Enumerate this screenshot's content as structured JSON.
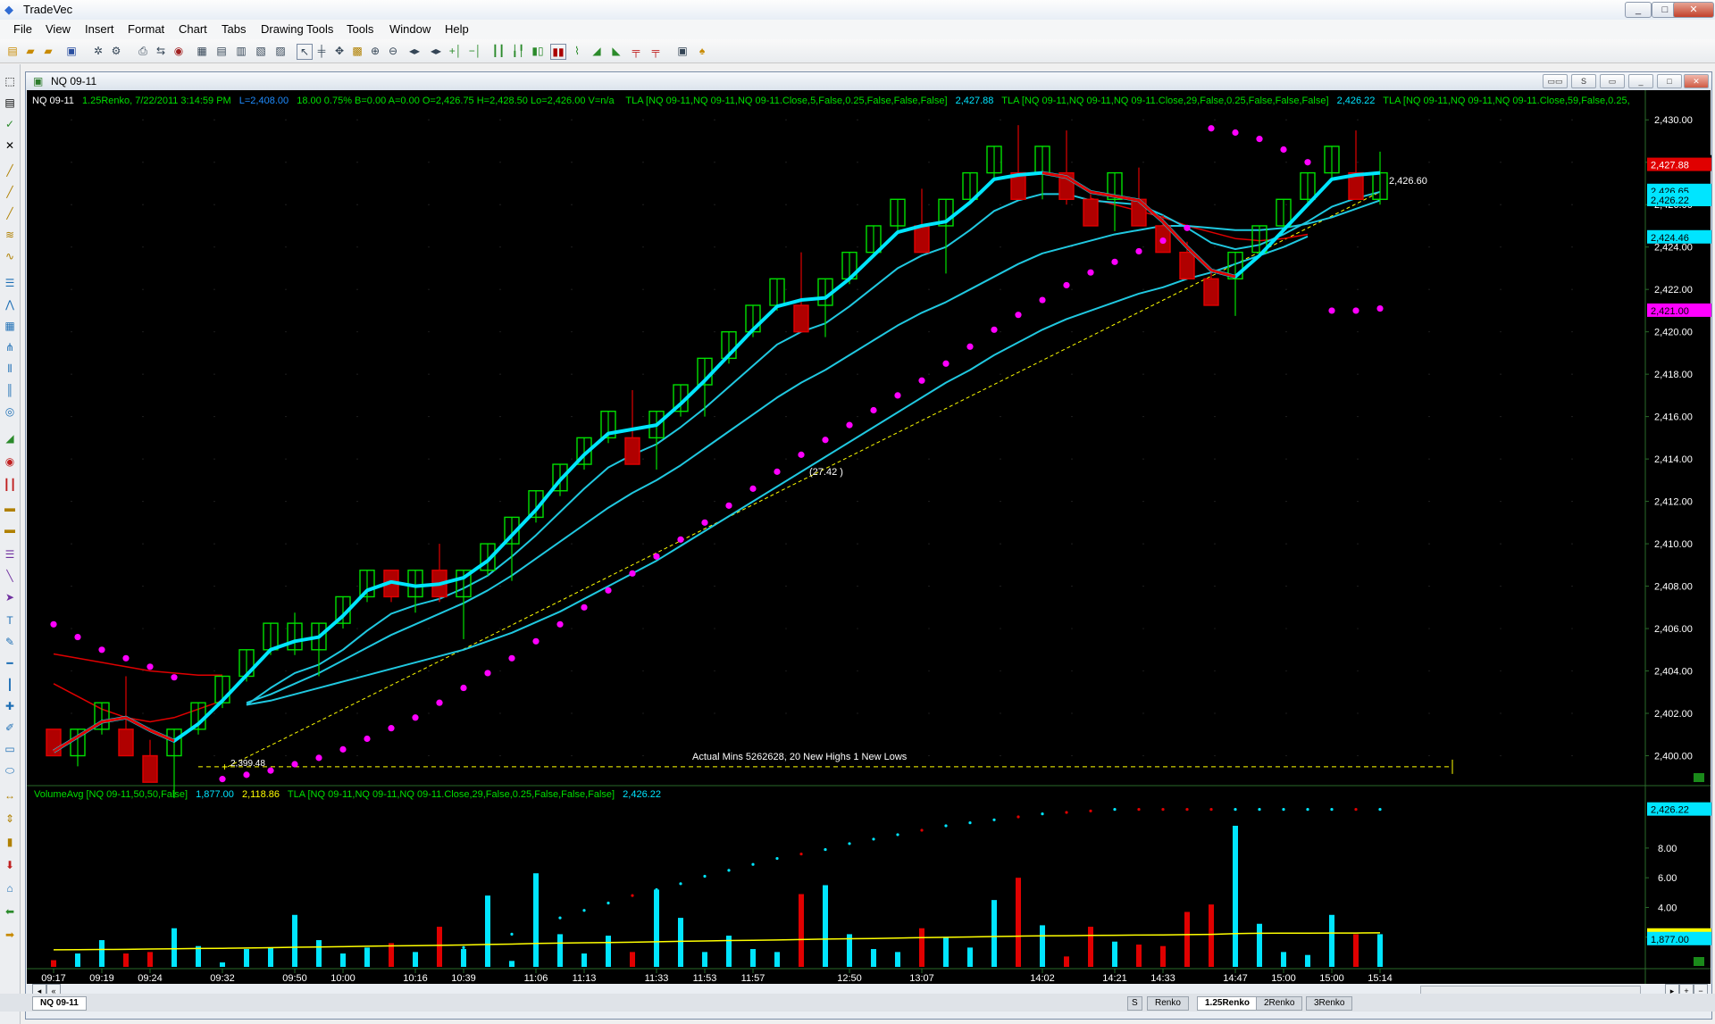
{
  "app": {
    "title": "TradeVec"
  },
  "window_buttons": [
    "_",
    "□",
    "✕"
  ],
  "menu": [
    "File",
    "View",
    "Insert",
    "Format",
    "Chart",
    "Tabs",
    "Drawing Tools",
    "Tools",
    "Window",
    "Help"
  ],
  "chart_window": {
    "title": "NQ 09-11",
    "tab_label": "NQ 09-11"
  },
  "info_line": {
    "symbol": "NQ 09-11",
    "details": "1.25Renko, 7/22/2011 3:14:59 PM",
    "last": "L=2,408.00",
    "stats": "18.00  0.75%  B=0.00  A=0.00  O=2,426.75  H=2,428.50  Lo=2,426.00  V=n/a",
    "tla1_label": "TLA  [NQ 09-11,NQ 09-11,NQ 09-11.Close,5,False,0.25,False,False,False]",
    "tla1_value": "2,427.88",
    "tla2_label": "TLA  [NQ 09-11,NQ 09-11,NQ 09-11.Close,29,False,0.25,False,False,False]",
    "tla2_value": "2,426.22",
    "tla3_label": "TLA  [NQ 09-11,NQ 09-11,NQ 09-11.Close,59,False,0.25,"
  },
  "vol_info_line": {
    "label": "VolumeAvg  [NQ 09-11,50,50,False]",
    "v1": "1,877.00",
    "v2": "2,118.86",
    "tla_label": "TLA  [NQ 09-11,NQ 09-11,NQ 09-11.Close,29,False,0.25,False,False,False]",
    "tla_value": "2,426.22"
  },
  "annotations": {
    "actual_mins": "Actual Mins 5262628, 20 New Highs 1 New Lows",
    "trend_label": "(27.42 )",
    "low_level": "2,399.48",
    "last_level": "2,426.60"
  },
  "price_badges": [
    {
      "text": "2,428.00",
      "value": 2428.0,
      "bg": "#000000",
      "fg": "#ffffff"
    },
    {
      "text": "2,427.88",
      "value": 2427.88,
      "bg": "#e00000",
      "fg": "#ffffff"
    },
    {
      "text": "2,426.65",
      "value": 2426.65,
      "bg": "#00e5ff",
      "fg": "#000000"
    },
    {
      "text": "2,426.22",
      "value": 2426.22,
      "bg": "#00e5ff",
      "fg": "#000000"
    },
    {
      "text": "2,424.46",
      "value": 2424.46,
      "bg": "#00e5ff",
      "fg": "#000000"
    },
    {
      "text": "2,421.00",
      "value": 2421.0,
      "bg": "#ff00ff",
      "fg": "#000000"
    }
  ],
  "vol_badges": [
    {
      "text": "2,426.22",
      "value": 10.6,
      "bg": "#00e5ff",
      "fg": "#000000"
    },
    {
      "text": "2,118.86",
      "value": 2.118,
      "bg": "#ffff00",
      "fg": "#000000"
    },
    {
      "text": "1,877.00",
      "value": 1.877,
      "bg": "#00e5ff",
      "fg": "#000000"
    }
  ],
  "bottom_tabs": [
    "S",
    "Renko",
    "1.25Renko",
    "2Renko",
    "3Renko"
  ],
  "active_tab": "1.25Renko",
  "colors": {
    "up": "#00e000",
    "down": "#e00000",
    "fast_ma": "#00e5ff",
    "slow_ma": "#20c8e0",
    "red_ma": "#e00000",
    "sar": "#ff00ff",
    "vol_avg": "#ffff00",
    "trend": "#ffff00"
  },
  "chart_data": {
    "type": "candlestick",
    "bar_type": "Renko 1.25",
    "price_axis": {
      "min": 2398.8,
      "max": 2430.6,
      "ticks": [
        2400,
        2402,
        2404,
        2406,
        2408,
        2410,
        2412,
        2414,
        2416,
        2418,
        2420,
        2422,
        2424,
        2426,
        2428,
        2430
      ]
    },
    "volume_axis": {
      "min": 0,
      "max": 11,
      "ticks": [
        2,
        4,
        6,
        8
      ]
    },
    "time_labels": [
      "09:17",
      "09:19",
      "09:24",
      "09:32",
      "09:50",
      "10:00",
      "10:16",
      "10:39",
      "11:06",
      "11:13",
      "11:33",
      "11:53",
      "11:57",
      "12:50",
      "13:07",
      "14:02",
      "14:21",
      "14:33",
      "14:47",
      "15:00",
      "15:00",
      "15:14"
    ],
    "time_label_bars": [
      0,
      2,
      4,
      7,
      10,
      12,
      15,
      17,
      20,
      22,
      25,
      27,
      29,
      33,
      36,
      41,
      44,
      46,
      49,
      51,
      53,
      55
    ],
    "candles": [
      {
        "dir": "down",
        "open": 2401.25,
        "close": 2400.0,
        "high": 2401.25,
        "low": 2400.0
      },
      {
        "dir": "up",
        "open": 2400.0,
        "close": 2401.25,
        "high": 2401.25,
        "low": 2399.5
      },
      {
        "dir": "up",
        "open": 2401.25,
        "close": 2402.5,
        "high": 2402.5,
        "low": 2401.0
      },
      {
        "dir": "down",
        "open": 2401.25,
        "close": 2400.0,
        "high": 2403.75,
        "low": 2400.0
      },
      {
        "dir": "down",
        "open": 2400.0,
        "close": 2398.75,
        "high": 2400.75,
        "low": 2398.75
      },
      {
        "dir": "up",
        "open": 2400.0,
        "close": 2401.25,
        "high": 2401.25,
        "low": 2398.0
      },
      {
        "dir": "up",
        "open": 2401.25,
        "close": 2402.5,
        "high": 2402.5,
        "low": 2401.0
      },
      {
        "dir": "up",
        "open": 2402.5,
        "close": 2403.75,
        "high": 2403.75,
        "low": 2402.25
      },
      {
        "dir": "up",
        "open": 2403.75,
        "close": 2405.0,
        "high": 2405.0,
        "low": 2403.5
      },
      {
        "dir": "up",
        "open": 2405.0,
        "close": 2406.25,
        "high": 2406.25,
        "low": 2404.75
      },
      {
        "dir": "up",
        "open": 2405.0,
        "close": 2406.25,
        "high": 2406.75,
        "low": 2404.75
      },
      {
        "dir": "up",
        "open": 2405.0,
        "close": 2406.25,
        "high": 2406.25,
        "low": 2403.75
      },
      {
        "dir": "up",
        "open": 2406.25,
        "close": 2407.5,
        "high": 2407.5,
        "low": 2406.0
      },
      {
        "dir": "up",
        "open": 2407.5,
        "close": 2408.75,
        "high": 2408.75,
        "low": 2407.25
      },
      {
        "dir": "down",
        "open": 2408.75,
        "close": 2407.5,
        "high": 2408.75,
        "low": 2407.25
      },
      {
        "dir": "up",
        "open": 2407.5,
        "close": 2408.75,
        "high": 2408.75,
        "low": 2406.75
      },
      {
        "dir": "down",
        "open": 2408.75,
        "close": 2407.5,
        "high": 2410.0,
        "low": 2407.25
      },
      {
        "dir": "up",
        "open": 2407.5,
        "close": 2408.75,
        "high": 2408.75,
        "low": 2405.5
      },
      {
        "dir": "up",
        "open": 2408.75,
        "close": 2410.0,
        "high": 2410.0,
        "low": 2408.5
      },
      {
        "dir": "up",
        "open": 2410.0,
        "close": 2411.25,
        "high": 2411.25,
        "low": 2408.25
      },
      {
        "dir": "up",
        "open": 2411.25,
        "close": 2412.5,
        "high": 2412.5,
        "low": 2411.0
      },
      {
        "dir": "up",
        "open": 2412.5,
        "close": 2413.75,
        "high": 2413.75,
        "low": 2412.25
      },
      {
        "dir": "up",
        "open": 2413.75,
        "close": 2415.0,
        "high": 2415.0,
        "low": 2413.5
      },
      {
        "dir": "up",
        "open": 2415.0,
        "close": 2416.25,
        "high": 2416.25,
        "low": 2414.75
      },
      {
        "dir": "down",
        "open": 2415.0,
        "close": 2413.75,
        "high": 2417.25,
        "low": 2413.75
      },
      {
        "dir": "up",
        "open": 2415.0,
        "close": 2416.25,
        "high": 2416.25,
        "low": 2413.5
      },
      {
        "dir": "up",
        "open": 2416.25,
        "close": 2417.5,
        "high": 2417.5,
        "low": 2416.0
      },
      {
        "dir": "up",
        "open": 2417.5,
        "close": 2418.75,
        "high": 2418.75,
        "low": 2416.0
      },
      {
        "dir": "up",
        "open": 2418.75,
        "close": 2420.0,
        "high": 2420.0,
        "low": 2418.5
      },
      {
        "dir": "up",
        "open": 2420.0,
        "close": 2421.25,
        "high": 2421.25,
        "low": 2419.75
      },
      {
        "dir": "up",
        "open": 2421.25,
        "close": 2422.5,
        "high": 2422.5,
        "low": 2421.0
      },
      {
        "dir": "down",
        "open": 2421.25,
        "close": 2420.0,
        "high": 2423.75,
        "low": 2420.0
      },
      {
        "dir": "up",
        "open": 2421.25,
        "close": 2422.5,
        "high": 2422.5,
        "low": 2419.75
      },
      {
        "dir": "up",
        "open": 2422.5,
        "close": 2423.75,
        "high": 2423.75,
        "low": 2422.25
      },
      {
        "dir": "up",
        "open": 2423.75,
        "close": 2425.0,
        "high": 2425.0,
        "low": 2423.5
      },
      {
        "dir": "up",
        "open": 2425.0,
        "close": 2426.25,
        "high": 2426.25,
        "low": 2424.75
      },
      {
        "dir": "down",
        "open": 2425.0,
        "close": 2423.75,
        "high": 2426.75,
        "low": 2423.75
      },
      {
        "dir": "up",
        "open": 2425.0,
        "close": 2426.25,
        "high": 2426.25,
        "low": 2422.75
      },
      {
        "dir": "up",
        "open": 2426.25,
        "close": 2427.5,
        "high": 2427.5,
        "low": 2426.0
      },
      {
        "dir": "up",
        "open": 2427.5,
        "close": 2428.75,
        "high": 2428.75,
        "low": 2427.25
      },
      {
        "dir": "down",
        "open": 2427.5,
        "close": 2426.25,
        "high": 2429.75,
        "low": 2426.25
      },
      {
        "dir": "up",
        "open": 2427.5,
        "close": 2428.75,
        "high": 2428.75,
        "low": 2426.25
      },
      {
        "dir": "down",
        "open": 2427.5,
        "close": 2426.25,
        "high": 2429.5,
        "low": 2426.0
      },
      {
        "dir": "down",
        "open": 2426.25,
        "close": 2425.0,
        "high": 2426.5,
        "low": 2425.0
      },
      {
        "dir": "up",
        "open": 2426.25,
        "close": 2427.5,
        "high": 2427.5,
        "low": 2424.75
      },
      {
        "dir": "down",
        "open": 2426.25,
        "close": 2425.0,
        "high": 2427.75,
        "low": 2425.0
      },
      {
        "dir": "down",
        "open": 2425.0,
        "close": 2423.75,
        "high": 2425.5,
        "low": 2423.75
      },
      {
        "dir": "down",
        "open": 2423.75,
        "close": 2422.5,
        "high": 2424.25,
        "low": 2422.5
      },
      {
        "dir": "down",
        "open": 2422.5,
        "close": 2421.25,
        "high": 2423.0,
        "low": 2421.25
      },
      {
        "dir": "up",
        "open": 2422.5,
        "close": 2423.75,
        "high": 2423.75,
        "low": 2420.75
      },
      {
        "dir": "up",
        "open": 2423.75,
        "close": 2425.0,
        "high": 2425.0,
        "low": 2423.5
      },
      {
        "dir": "up",
        "open": 2425.0,
        "close": 2426.25,
        "high": 2426.25,
        "low": 2424.75
      },
      {
        "dir": "up",
        "open": 2426.25,
        "close": 2427.5,
        "high": 2427.5,
        "low": 2426.0
      },
      {
        "dir": "up",
        "open": 2427.5,
        "close": 2428.75,
        "high": 2428.75,
        "low": 2427.25
      },
      {
        "dir": "down",
        "open": 2427.5,
        "close": 2426.25,
        "high": 2429.5,
        "low": 2426.25
      },
      {
        "dir": "up",
        "open": 2426.25,
        "close": 2427.5,
        "high": 2428.5,
        "low": 2426.0
      }
    ],
    "ma_fast": [
      2400.2,
      2400.9,
      2401.6,
      2401.8,
      2401.2,
      2400.7,
      2401.5,
      2402.6,
      2403.8,
      2405.0,
      2405.4,
      2405.6,
      2406.6,
      2407.8,
      2408.2,
      2408.0,
      2408.1,
      2408.4,
      2409.2,
      2410.4,
      2411.6,
      2413.0,
      2414.2,
      2415.2,
      2415.4,
      2415.6,
      2416.6,
      2417.7,
      2418.9,
      2420.1,
      2421.2,
      2421.5,
      2421.6,
      2422.5,
      2423.6,
      2424.7,
      2425.0,
      2425.2,
      2426.1,
      2427.2,
      2427.4,
      2427.5,
      2427.3,
      2426.6,
      2426.4,
      2426.2,
      2425.2,
      2424.0,
      2422.9,
      2422.6,
      2423.6,
      2424.8,
      2426.0,
      2427.2,
      2427.4,
      2427.5
    ],
    "ma_mid": [
      null,
      null,
      null,
      null,
      null,
      null,
      null,
      null,
      2402.4,
      2403.2,
      2403.9,
      2404.3,
      2405.0,
      2405.9,
      2406.7,
      2407.1,
      2407.4,
      2407.9,
      2408.5,
      2409.4,
      2410.4,
      2411.5,
      2412.6,
      2413.6,
      2414.2,
      2414.7,
      2415.5,
      2416.4,
      2417.4,
      2418.4,
      2419.4,
      2420.0,
      2420.4,
      2421.2,
      2422.1,
      2423.0,
      2423.6,
      2424.0,
      2424.8,
      2425.7,
      2426.2,
      2426.5,
      2426.5,
      2426.2,
      2426.1,
      2426.0,
      2425.5,
      2424.9,
      2424.2,
      2423.9,
      2424.1,
      2424.6,
      2425.2,
      2425.9,
      2426.3,
      2426.6
    ],
    "ma_slow": [
      null,
      null,
      null,
      null,
      null,
      null,
      null,
      null,
      2402.5,
      2402.9,
      2403.4,
      2403.9,
      2404.5,
      2405.1,
      2405.7,
      2406.2,
      2406.7,
      2407.2,
      2407.8,
      2408.5,
      2409.3,
      2410.1,
      2410.9,
      2411.7,
      2412.4,
      2413.0,
      2413.7,
      2414.5,
      2415.3,
      2416.1,
      2416.9,
      2417.6,
      2418.2,
      2418.9,
      2419.6,
      2420.3,
      2420.9,
      2421.4,
      2422.0,
      2422.6,
      2423.2,
      2423.7,
      2424.0,
      2424.3,
      2424.6,
      2424.8,
      2425.0,
      2425.0,
      2424.9,
      2424.8,
      2424.8,
      2424.9,
      2425.1,
      2425.4,
      2425.8,
      2426.2
    ],
    "ma_slow2": [
      null,
      null,
      null,
      null,
      null,
      null,
      null,
      null,
      2402.4,
      2402.6,
      2402.9,
      2403.2,
      2403.5,
      2403.8,
      2404.1,
      2404.4,
      2404.7,
      2405.0,
      2405.4,
      2405.8,
      2406.3,
      2406.8,
      2407.4,
      2408.0,
      2408.6,
      2409.2,
      2409.9,
      2410.6,
      2411.3,
      2412.0,
      2412.7,
      2413.4,
      2414.1,
      2414.8,
      2415.5,
      2416.2,
      2416.9,
      2417.6,
      2418.2,
      2418.9,
      2419.5,
      2420.1,
      2420.6,
      2421.0,
      2421.4,
      2421.8,
      2422.1,
      2422.5,
      2422.8,
      2423.2,
      2423.6,
      2424.0,
      2424.5
    ],
    "red_ma_a": [
      2404.8,
      2404.6,
      2404.4,
      2404.2,
      2404.0,
      2403.9,
      2403.8,
      2403.8
    ],
    "red_ma_b": [
      2403.4,
      2402.8,
      2402.2,
      2401.8,
      2401.6,
      2401.8,
      2402.2,
      2402.6
    ],
    "red_ma_late": [
      2426.3,
      2426.0,
      2425.7,
      2425.4,
      2425.0,
      2424.7,
      2424.4,
      2424.3,
      2424.4,
      2424.6
    ],
    "red_ma_late_start": 43,
    "sar": [
      2406.2,
      2405.6,
      2405.0,
      2404.6,
      2404.2,
      2403.7,
      null,
      2398.9,
      2399.1,
      2399.3,
      2399.6,
      2399.9,
      2400.3,
      2400.8,
      2401.3,
      2401.8,
      2402.5,
      2403.2,
      2403.9,
      2404.6,
      2405.4,
      2406.2,
      2407.0,
      2407.8,
      2408.6,
      2409.4,
      2410.2,
      2411.0,
      2411.8,
      2412.6,
      2413.4,
      2414.2,
      2414.9,
      2415.6,
      2416.3,
      2417.0,
      2417.7,
      2418.5,
      2419.3,
      2420.1,
      2420.8,
      2421.5,
      2422.2,
      2422.8,
      2423.3,
      2423.8,
      2424.3,
      2424.9,
      2429.6,
      2429.4,
      2429.1,
      2428.6,
      2428.0,
      2421.0,
      2421.0,
      2421.1
    ],
    "volume": [
      0.45,
      0.9,
      1.8,
      0.9,
      1.0,
      2.6,
      1.4,
      0.3,
      1.2,
      1.3,
      3.5,
      1.8,
      0.9,
      1.3,
      1.6,
      1.0,
      2.7,
      1.2,
      4.8,
      0.4,
      6.3,
      2.2,
      0.9,
      2.1,
      1.0,
      5.2,
      3.3,
      1.0,
      2.1,
      1.2,
      1.0,
      4.9,
      5.5,
      2.2,
      1.2,
      1.0,
      2.6,
      2.0,
      1.3,
      4.5,
      6.0,
      2.8,
      0.7,
      2.7,
      1.7,
      1.5,
      1.4,
      3.7,
      4.2,
      9.5,
      2.9,
      1.0,
      0.8,
      3.5,
      2.2,
      2.2
    ],
    "volume_avg": [
      1.15,
      1.16,
      1.17,
      1.18,
      1.2,
      1.22,
      1.24,
      1.25,
      1.27,
      1.29,
      1.32,
      1.34,
      1.36,
      1.39,
      1.41,
      1.43,
      1.45,
      1.47,
      1.51,
      1.53,
      1.58,
      1.6,
      1.62,
      1.64,
      1.66,
      1.69,
      1.72,
      1.74,
      1.77,
      1.79,
      1.81,
      1.84,
      1.87,
      1.89,
      1.91,
      1.94,
      1.97,
      1.99,
      2.01,
      2.04,
      2.07,
      2.09,
      2.1,
      2.12,
      2.13,
      2.14,
      2.15,
      2.17,
      2.19,
      2.24,
      2.26,
      2.27,
      2.27,
      2.28,
      2.28,
      2.29
    ],
    "vol_tla_dots": [
      null,
      null,
      null,
      null,
      null,
      null,
      null,
      null,
      null,
      null,
      null,
      null,
      null,
      null,
      null,
      null,
      null,
      1.3,
      1.7,
      2.2,
      2.7,
      3.3,
      3.8,
      4.3,
      4.8,
      5.2,
      5.6,
      6.1,
      6.5,
      6.9,
      7.3,
      7.6,
      7.9,
      8.3,
      8.6,
      8.9,
      9.2,
      9.5,
      9.7,
      9.9,
      10.1,
      10.3,
      10.4,
      10.5,
      10.6,
      10.6,
      10.6,
      10.6,
      10.6,
      10.6,
      10.6,
      10.6,
      10.6,
      10.6,
      10.6,
      10.6
    ]
  }
}
